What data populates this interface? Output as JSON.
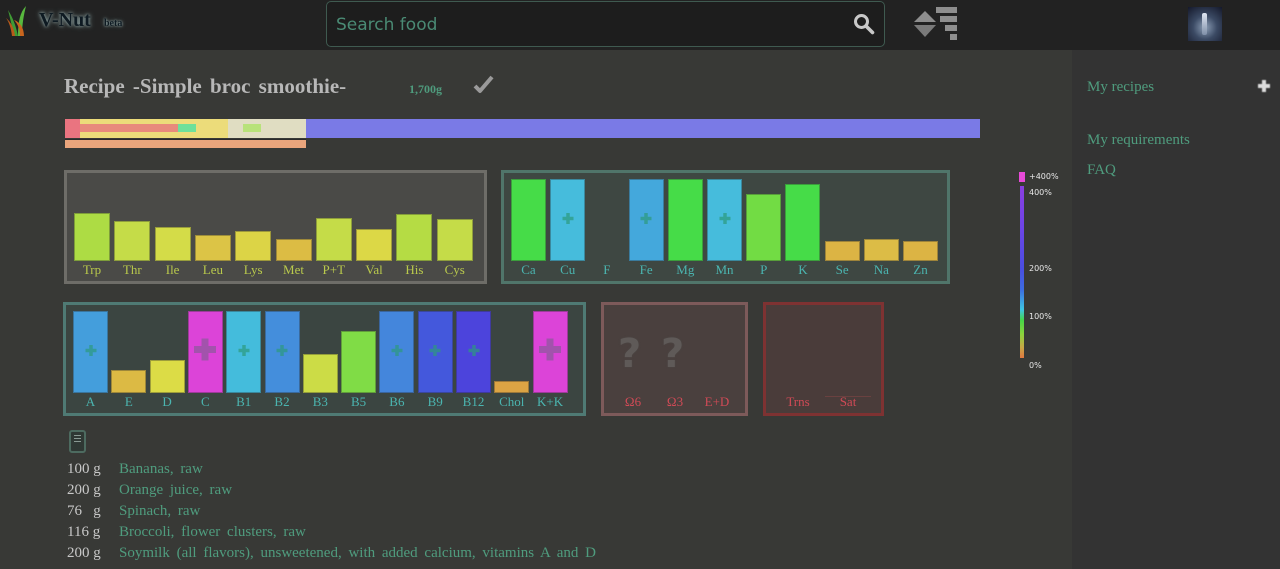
{
  "header": {
    "brand": "V-Nut",
    "badge": "beta",
    "search_placeholder": "Search food",
    "icons": {
      "logo": "leaf-logo-icon",
      "search": "search-icon",
      "sort": "sort-icon",
      "avatar": "user-avatar"
    }
  },
  "sidebar": {
    "items": [
      {
        "label": "My recipes",
        "icon": "plus-icon"
      },
      {
        "label": "My requirements"
      },
      {
        "label": "FAQ"
      }
    ]
  },
  "recipe": {
    "title": "Recipe -Simple broc smoothie-",
    "weight": "1,700g",
    "confirm_icon": "checkmark-icon"
  },
  "macro_bar": {
    "segments": [
      {
        "name": "segment-1",
        "start": 0,
        "end": 0.016,
        "color": "#ea7480"
      },
      {
        "name": "segment-2",
        "start": 0.016,
        "end": 0.178,
        "color": "#ecdc7a"
      },
      {
        "name": "segment-3",
        "start": 0.178,
        "end": 0.263,
        "color": "#e0ddc2"
      },
      {
        "name": "segment-4",
        "start": 0.263,
        "end": 1.0,
        "color": "#7a7ae6"
      }
    ],
    "overlays": [
      {
        "name": "overlay-red",
        "start": 0.016,
        "end": 0.124,
        "color": "#e88a7c"
      },
      {
        "name": "overlay-green",
        "start": 0.124,
        "end": 0.143,
        "color": "#6ee09a"
      },
      {
        "name": "overlay-lightgreen",
        "start": 0.195,
        "end": 0.214,
        "color": "#b8e27a"
      }
    ],
    "secondary": {
      "fraction": 0.263,
      "color": "#eaa57c"
    }
  },
  "panels": {
    "amino": [
      {
        "label": "Trp",
        "pct": 60,
        "color": "#addc44"
      },
      {
        "label": "Thr",
        "pct": 50,
        "color": "#c5dc48"
      },
      {
        "label": "Ile",
        "pct": 43,
        "color": "#d4dc48"
      },
      {
        "label": "Leu",
        "pct": 32,
        "color": "#dcc446"
      },
      {
        "label": "Lys",
        "pct": 37,
        "color": "#dcd446"
      },
      {
        "label": "Met",
        "pct": 28,
        "color": "#dcbc44"
      },
      {
        "label": "P+T",
        "pct": 54,
        "color": "#c5dc48"
      },
      {
        "label": "Val",
        "pct": 40,
        "color": "#dcd846"
      },
      {
        "label": "His",
        "pct": 59,
        "color": "#b5dc44"
      },
      {
        "label": "Cys",
        "pct": 53,
        "color": "#c5dc48"
      }
    ],
    "minerals": [
      {
        "label": "Ca",
        "pct": 100,
        "color": "#46dc48",
        "plus": false
      },
      {
        "label": "Cu",
        "pct": 100,
        "color": "#46bcdc",
        "plus": true
      },
      {
        "label": "F",
        "pct": 0,
        "color": "#46dc48",
        "plus": false
      },
      {
        "label": "Fe",
        "pct": 100,
        "color": "#44a8dc",
        "plus": true
      },
      {
        "label": "Mg",
        "pct": 100,
        "color": "#46dc48",
        "plus": false
      },
      {
        "label": "Mn",
        "pct": 100,
        "color": "#46bcdc",
        "plus": true
      },
      {
        "label": "P",
        "pct": 82,
        "color": "#72dc44",
        "plus": false
      },
      {
        "label": "K",
        "pct": 94,
        "color": "#46dc48",
        "plus": false
      },
      {
        "label": "Se",
        "pct": 24,
        "color": "#dcb444",
        "plus": false
      },
      {
        "label": "Na",
        "pct": 27,
        "color": "#dcbc46",
        "plus": false
      },
      {
        "label": "Zn",
        "pct": 25,
        "color": "#dcb444",
        "plus": false
      }
    ],
    "vitamins": [
      {
        "label": "A",
        "pct": 100,
        "color": "#449edc",
        "plus": "small"
      },
      {
        "label": "E",
        "pct": 28,
        "color": "#dcba44",
        "plus": ""
      },
      {
        "label": "D",
        "pct": 40,
        "color": "#dcdc46",
        "plus": ""
      },
      {
        "label": "C",
        "pct": 100,
        "color": "#dc44d8",
        "plus": "large"
      },
      {
        "label": "B1",
        "pct": 100,
        "color": "#44bcdc",
        "plus": "small"
      },
      {
        "label": "B2",
        "pct": 100,
        "color": "#448edc",
        "plus": "small"
      },
      {
        "label": "B3",
        "pct": 47,
        "color": "#ccdc46",
        "plus": ""
      },
      {
        "label": "B5",
        "pct": 76,
        "color": "#80dc46",
        "plus": ""
      },
      {
        "label": "B6",
        "pct": 100,
        "color": "#4486dc",
        "plus": "small"
      },
      {
        "label": "B9",
        "pct": 100,
        "color": "#4458dc",
        "plus": "small"
      },
      {
        "label": "B12",
        "pct": 100,
        "color": "#4c44dc",
        "plus": "small"
      },
      {
        "label": "Chol",
        "pct": 15,
        "color": "#dca444",
        "plus": ""
      },
      {
        "label": "K+K",
        "pct": 100,
        "color": "#dc44d8",
        "plus": "large"
      }
    ],
    "fats": [
      {
        "label": "Ω6",
        "value": "?"
      },
      {
        "label": "Ω3",
        "value": "?"
      },
      {
        "label": "E+D",
        "value": ""
      }
    ],
    "bad_fats": [
      {
        "label": "Trns"
      },
      {
        "label": "Sat"
      }
    ]
  },
  "scale": {
    "labels": [
      "+400%",
      "400%",
      "200%",
      "100%",
      "0%"
    ]
  },
  "ingredients": [
    {
      "qty": "100 g",
      "name": "Bananas, raw"
    },
    {
      "qty": "200 g",
      "name": "Orange juice, raw"
    },
    {
      "qty": "76   g",
      "name": "Spinach, raw"
    },
    {
      "qty": "116 g",
      "name": "Broccoli, flower clusters, raw"
    },
    {
      "qty": "200 g",
      "name": "Soymilk (all flavors), unsweetened, with added calcium, vitamins A and D"
    }
  ]
}
